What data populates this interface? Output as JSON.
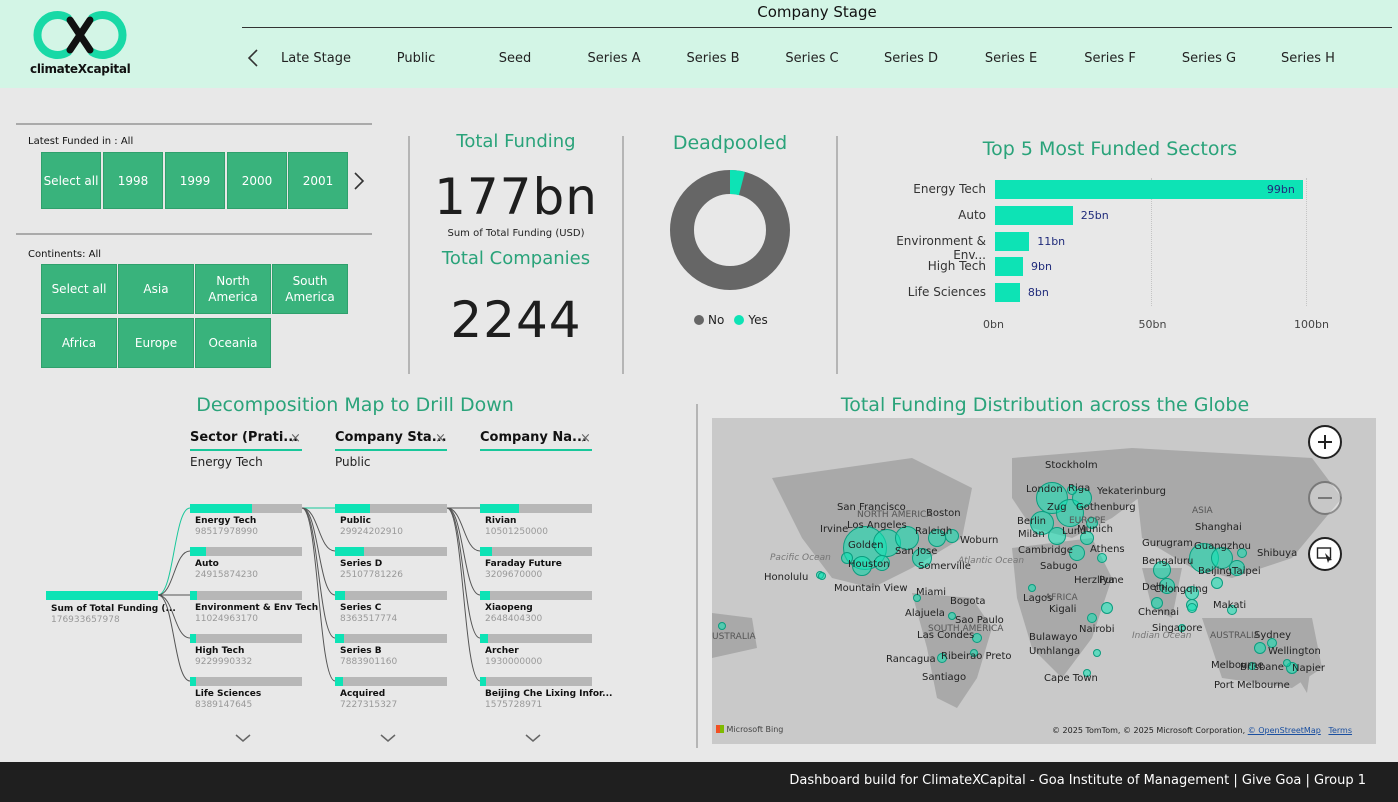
{
  "header": {
    "logo_text": "climateXcapital",
    "stage_title": "Company Stage",
    "stages": [
      "Late Stage",
      "Public",
      "Seed",
      "Series A",
      "Series B",
      "Series C",
      "Series D",
      "Series E",
      "Series F",
      "Series G",
      "Series H"
    ]
  },
  "slicers": {
    "funded_label": "Latest Funded in : All",
    "years": [
      "Select all",
      "1998",
      "1999",
      "2000",
      "2001"
    ],
    "continents_label": "Continents: All",
    "continents": [
      "Select all",
      "Asia",
      "North America",
      "South America",
      "Africa",
      "Europe",
      "Oceania"
    ]
  },
  "kpis": {
    "total_funding_title": "Total Funding",
    "total_funding_value": "177bn",
    "total_funding_sub": "Sum of Total Funding (USD)",
    "total_companies_title": "Total Companies",
    "total_companies_value": "2244"
  },
  "deadpooled": {
    "title": "Deadpooled",
    "legend_no": "No",
    "legend_yes": "Yes",
    "no_color": "#666666",
    "yes_color": "#0de3b5",
    "yes_fraction": 0.04
  },
  "chart_data": {
    "type": "bar",
    "title": "Top 5 Most Funded Sectors",
    "categories": [
      "Energy Tech",
      "Auto",
      "Environment & Env...",
      "High Tech",
      "Life Sciences"
    ],
    "values": [
      99,
      25,
      11,
      9,
      8
    ],
    "data_labels": [
      "99bn",
      "25bn",
      "11bn",
      "9bn",
      "8bn"
    ],
    "xlim": [
      0,
      100
    ],
    "ticks": [
      "0bn",
      "50bn",
      "100bn"
    ],
    "bar_color": "#0de3b5"
  },
  "decomposition": {
    "title": "Decomposition Map to Drill Down",
    "root": {
      "name": "Sum of Total Funding (...",
      "value": "176933657978"
    },
    "columns": [
      {
        "header": "Sector (Prati...",
        "selected": "Energy Tech",
        "nodes": [
          {
            "name": "Energy Tech",
            "value": "98517978990",
            "fill": 0.55
          },
          {
            "name": "Auto",
            "value": "24915874230",
            "fill": 0.14
          },
          {
            "name": "Environment & Env Tech",
            "value": "11024963170",
            "fill": 0.06
          },
          {
            "name": "High Tech",
            "value": "9229990332",
            "fill": 0.05
          },
          {
            "name": "Life Sciences",
            "value": "8389147645",
            "fill": 0.05
          }
        ]
      },
      {
        "header": "Company Sta...",
        "selected": "Public",
        "nodes": [
          {
            "name": "Public",
            "value": "29924202910",
            "fill": 0.31
          },
          {
            "name": "Series D",
            "value": "25107781226",
            "fill": 0.26
          },
          {
            "name": "Series C",
            "value": "8363517774",
            "fill": 0.09
          },
          {
            "name": "Series B",
            "value": "7883901160",
            "fill": 0.08
          },
          {
            "name": "Acquired",
            "value": "7227315327",
            "fill": 0.07
          }
        ]
      },
      {
        "header": "Company Na...",
        "selected": "",
        "nodes": [
          {
            "name": "Rivian",
            "value": "10501250000",
            "fill": 0.35
          },
          {
            "name": "Faraday Future",
            "value": "3209670000",
            "fill": 0.11
          },
          {
            "name": "Xiaopeng",
            "value": "2648404300",
            "fill": 0.09
          },
          {
            "name": "Archer",
            "value": "1930000000",
            "fill": 0.07
          },
          {
            "name": "Beijing Che Lixing Infor...",
            "value": "1575728971",
            "fill": 0.05
          }
        ]
      }
    ]
  },
  "map": {
    "title": "Total Funding Distribution across the Globe",
    "labels": [
      "Stockholm",
      "London",
      "Riga",
      "Yekaterinburg",
      "Zug",
      "Gothenburg",
      "San Francisco",
      "Boston",
      "Los Angeles",
      "Raleigh",
      "Woburn",
      "Golden",
      "Berlin",
      "Milan",
      "Lund",
      "Munich",
      "Irvine",
      "San Jose",
      "Houston",
      "Somerville",
      "Cambridge",
      "Athens",
      "Honolulu",
      "Sabugo",
      "Mountain View",
      "Lagos",
      "Bogota",
      "Kigali",
      "Miami",
      "Alajuela",
      "Sao Paulo",
      "Las Condes",
      "Nairobi",
      "Bulawayo",
      "Rancagua",
      "Ribeirao Preto",
      "Umhlanga",
      "Santiago",
      "Cape Town",
      "Gurugram",
      "Bengaluru",
      "Herzliya",
      "Pune",
      "Delhi",
      "Chennai",
      "Chongqing",
      "Makati",
      "Singapore",
      "Shanghai",
      "Guangzhou",
      "Shibuya",
      "Beijing",
      "Taipei",
      "Sydney",
      "Wellington",
      "Melbourne",
      "Brisbane",
      "Napier",
      "Port Melbourne"
    ],
    "region_labels": [
      "NORTH AMERICA",
      "EUROPE",
      "ASIA",
      "AFRICA",
      "SOUTH AMERICA",
      "AUSTRALIA",
      "USTRALIA"
    ],
    "oceans": [
      "Pacific Ocean",
      "Atlantic Ocean",
      "Indian Ocean"
    ],
    "bing": "Microsoft Bing",
    "attribution": "© 2025 TomTom, © 2025 Microsoft Corporation,",
    "osm": "© OpenStreetMap",
    "terms": "Terms"
  },
  "footer": {
    "text": "Dashboard build for ClimateXCapital - Goa Institute of Management | Give Goa | Group 1"
  }
}
